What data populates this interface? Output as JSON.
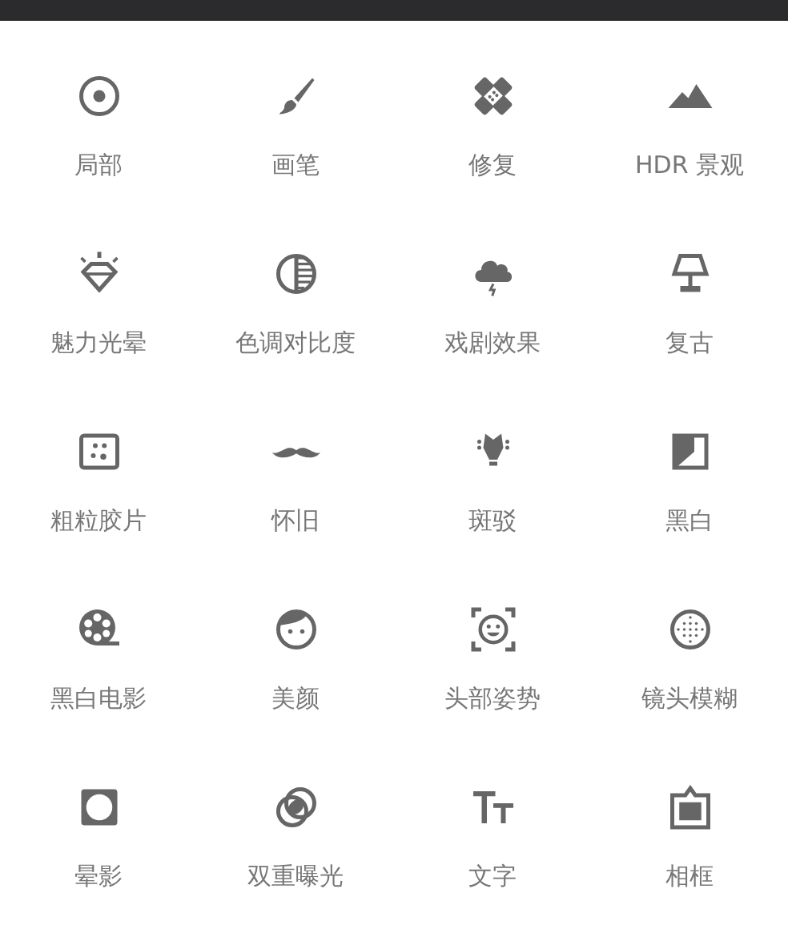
{
  "tools": [
    {
      "kind": "target",
      "label": "局部"
    },
    {
      "kind": "brush",
      "label": "画笔"
    },
    {
      "kind": "bandage",
      "label": "修复"
    },
    {
      "kind": "mountains",
      "label": "HDR 景观"
    },
    {
      "kind": "diamond",
      "label": "魅力光晕"
    },
    {
      "kind": "contrast",
      "label": "色调对比度"
    },
    {
      "kind": "storm",
      "label": "戏剧效果"
    },
    {
      "kind": "lamp",
      "label": "复古"
    },
    {
      "kind": "grain",
      "label": "粗粒胶片"
    },
    {
      "kind": "mustache",
      "label": "怀旧"
    },
    {
      "kind": "guitar",
      "label": "斑驳"
    },
    {
      "kind": "bw",
      "label": "黑白"
    },
    {
      "kind": "reel",
      "label": "黑白电影"
    },
    {
      "kind": "face",
      "label": "美颜"
    },
    {
      "kind": "face-frame",
      "label": "头部姿势"
    },
    {
      "kind": "lens",
      "label": "镜头模糊"
    },
    {
      "kind": "vignette",
      "label": "晕影"
    },
    {
      "kind": "circles",
      "label": "双重曝光"
    },
    {
      "kind": "type",
      "label": "文字"
    },
    {
      "kind": "frame",
      "label": "相框"
    }
  ]
}
